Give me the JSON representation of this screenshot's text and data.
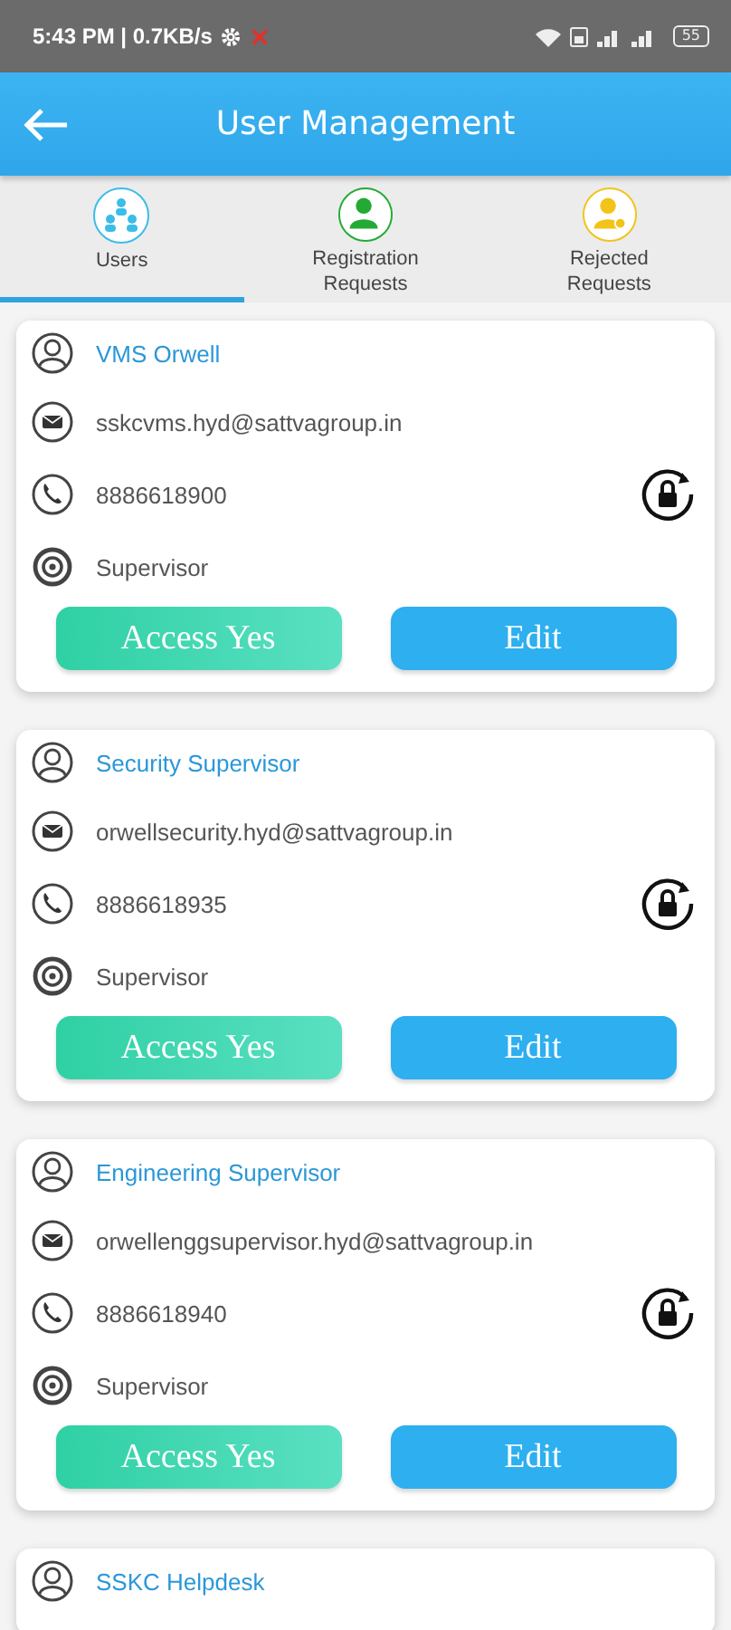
{
  "status_bar": {
    "time": "5:43 PM | 0.7KB/s",
    "battery": "55"
  },
  "app_bar": {
    "title": "User Management"
  },
  "tabs": [
    {
      "label": "Users",
      "selected": true,
      "color": "#3bbde8"
    },
    {
      "label": "Registration Requests",
      "selected": false,
      "color": "#22aa33"
    },
    {
      "label": "Rejected Requests",
      "selected": false,
      "color": "#f2c318"
    }
  ],
  "users": [
    {
      "name": "VMS Orwell",
      "email": "sskcvms.hyd@sattvagroup.in",
      "phone": "8886618900",
      "role": "Supervisor",
      "access_button": "Access Yes",
      "edit_button": "Edit"
    },
    {
      "name": "Security Supervisor",
      "email": "orwellsecurity.hyd@sattvagroup.in",
      "phone": "8886618935",
      "role": "Supervisor",
      "access_button": "Access Yes",
      "edit_button": "Edit"
    },
    {
      "name": "Engineering Supervisor",
      "email": "orwellenggsupervisor.hyd@sattvagroup.in",
      "phone": "8886618940",
      "role": "Supervisor",
      "access_button": "Access Yes",
      "edit_button": "Edit"
    },
    {
      "name": "SSKC Helpdesk"
    }
  ]
}
